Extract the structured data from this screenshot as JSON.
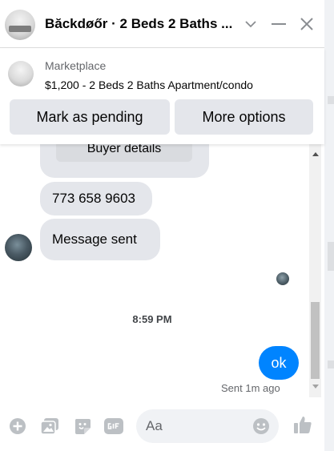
{
  "header": {
    "title": "Băckdøőr · 2 Beds 2 Baths ...",
    "icons": [
      "listing-thumbnail",
      "chevron-down-icon",
      "minimize-icon",
      "close-icon"
    ]
  },
  "listing": {
    "source": "Marketplace",
    "description": "$1,200 - 2 Beds 2 Baths Apartment/condo",
    "buttons": {
      "mark_pending": "Mark as pending",
      "more_options": "More options"
    }
  },
  "thread": {
    "messages": [
      {
        "type": "incoming",
        "button_label": "Buyer details"
      },
      {
        "type": "incoming",
        "text": "773 658 9603"
      },
      {
        "type": "incoming",
        "text": "Message sent"
      },
      {
        "type": "timestamp",
        "text": "8:59 PM"
      },
      {
        "type": "outgoing",
        "text": "ok"
      }
    ],
    "status": "Sent 1m ago"
  },
  "composer": {
    "placeholder": "Aa",
    "icons": [
      "plus-icon",
      "photo-icon",
      "sticker-icon",
      "gif-icon",
      "emoji-icon",
      "thumbs-up-icon"
    ]
  },
  "colors": {
    "accent": "#0084ff",
    "bubble_gray": "#e4e6eb",
    "icon_gray": "#bcc0c4"
  }
}
